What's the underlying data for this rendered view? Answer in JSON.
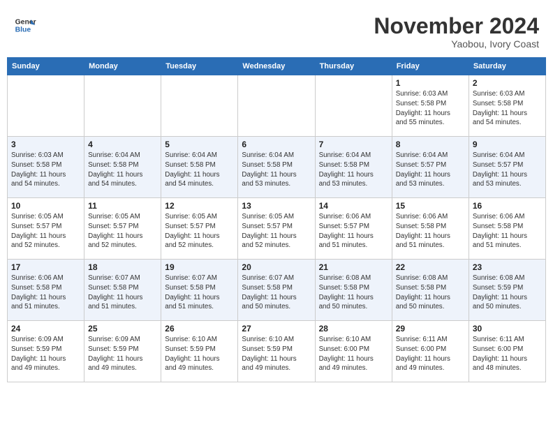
{
  "header": {
    "logo_line1": "General",
    "logo_line2": "Blue",
    "month": "November 2024",
    "location": "Yaobou, Ivory Coast"
  },
  "weekdays": [
    "Sunday",
    "Monday",
    "Tuesday",
    "Wednesday",
    "Thursday",
    "Friday",
    "Saturday"
  ],
  "weeks": [
    [
      {
        "day": "",
        "info": ""
      },
      {
        "day": "",
        "info": ""
      },
      {
        "day": "",
        "info": ""
      },
      {
        "day": "",
        "info": ""
      },
      {
        "day": "",
        "info": ""
      },
      {
        "day": "1",
        "info": "Sunrise: 6:03 AM\nSunset: 5:58 PM\nDaylight: 11 hours\nand 55 minutes."
      },
      {
        "day": "2",
        "info": "Sunrise: 6:03 AM\nSunset: 5:58 PM\nDaylight: 11 hours\nand 54 minutes."
      }
    ],
    [
      {
        "day": "3",
        "info": "Sunrise: 6:03 AM\nSunset: 5:58 PM\nDaylight: 11 hours\nand 54 minutes."
      },
      {
        "day": "4",
        "info": "Sunrise: 6:04 AM\nSunset: 5:58 PM\nDaylight: 11 hours\nand 54 minutes."
      },
      {
        "day": "5",
        "info": "Sunrise: 6:04 AM\nSunset: 5:58 PM\nDaylight: 11 hours\nand 54 minutes."
      },
      {
        "day": "6",
        "info": "Sunrise: 6:04 AM\nSunset: 5:58 PM\nDaylight: 11 hours\nand 53 minutes."
      },
      {
        "day": "7",
        "info": "Sunrise: 6:04 AM\nSunset: 5:58 PM\nDaylight: 11 hours\nand 53 minutes."
      },
      {
        "day": "8",
        "info": "Sunrise: 6:04 AM\nSunset: 5:57 PM\nDaylight: 11 hours\nand 53 minutes."
      },
      {
        "day": "9",
        "info": "Sunrise: 6:04 AM\nSunset: 5:57 PM\nDaylight: 11 hours\nand 53 minutes."
      }
    ],
    [
      {
        "day": "10",
        "info": "Sunrise: 6:05 AM\nSunset: 5:57 PM\nDaylight: 11 hours\nand 52 minutes."
      },
      {
        "day": "11",
        "info": "Sunrise: 6:05 AM\nSunset: 5:57 PM\nDaylight: 11 hours\nand 52 minutes."
      },
      {
        "day": "12",
        "info": "Sunrise: 6:05 AM\nSunset: 5:57 PM\nDaylight: 11 hours\nand 52 minutes."
      },
      {
        "day": "13",
        "info": "Sunrise: 6:05 AM\nSunset: 5:57 PM\nDaylight: 11 hours\nand 52 minutes."
      },
      {
        "day": "14",
        "info": "Sunrise: 6:06 AM\nSunset: 5:57 PM\nDaylight: 11 hours\nand 51 minutes."
      },
      {
        "day": "15",
        "info": "Sunrise: 6:06 AM\nSunset: 5:58 PM\nDaylight: 11 hours\nand 51 minutes."
      },
      {
        "day": "16",
        "info": "Sunrise: 6:06 AM\nSunset: 5:58 PM\nDaylight: 11 hours\nand 51 minutes."
      }
    ],
    [
      {
        "day": "17",
        "info": "Sunrise: 6:06 AM\nSunset: 5:58 PM\nDaylight: 11 hours\nand 51 minutes."
      },
      {
        "day": "18",
        "info": "Sunrise: 6:07 AM\nSunset: 5:58 PM\nDaylight: 11 hours\nand 51 minutes."
      },
      {
        "day": "19",
        "info": "Sunrise: 6:07 AM\nSunset: 5:58 PM\nDaylight: 11 hours\nand 51 minutes."
      },
      {
        "day": "20",
        "info": "Sunrise: 6:07 AM\nSunset: 5:58 PM\nDaylight: 11 hours\nand 50 minutes."
      },
      {
        "day": "21",
        "info": "Sunrise: 6:08 AM\nSunset: 5:58 PM\nDaylight: 11 hours\nand 50 minutes."
      },
      {
        "day": "22",
        "info": "Sunrise: 6:08 AM\nSunset: 5:58 PM\nDaylight: 11 hours\nand 50 minutes."
      },
      {
        "day": "23",
        "info": "Sunrise: 6:08 AM\nSunset: 5:59 PM\nDaylight: 11 hours\nand 50 minutes."
      }
    ],
    [
      {
        "day": "24",
        "info": "Sunrise: 6:09 AM\nSunset: 5:59 PM\nDaylight: 11 hours\nand 49 minutes."
      },
      {
        "day": "25",
        "info": "Sunrise: 6:09 AM\nSunset: 5:59 PM\nDaylight: 11 hours\nand 49 minutes."
      },
      {
        "day": "26",
        "info": "Sunrise: 6:10 AM\nSunset: 5:59 PM\nDaylight: 11 hours\nand 49 minutes."
      },
      {
        "day": "27",
        "info": "Sunrise: 6:10 AM\nSunset: 5:59 PM\nDaylight: 11 hours\nand 49 minutes."
      },
      {
        "day": "28",
        "info": "Sunrise: 6:10 AM\nSunset: 6:00 PM\nDaylight: 11 hours\nand 49 minutes."
      },
      {
        "day": "29",
        "info": "Sunrise: 6:11 AM\nSunset: 6:00 PM\nDaylight: 11 hours\nand 49 minutes."
      },
      {
        "day": "30",
        "info": "Sunrise: 6:11 AM\nSunset: 6:00 PM\nDaylight: 11 hours\nand 48 minutes."
      }
    ]
  ]
}
